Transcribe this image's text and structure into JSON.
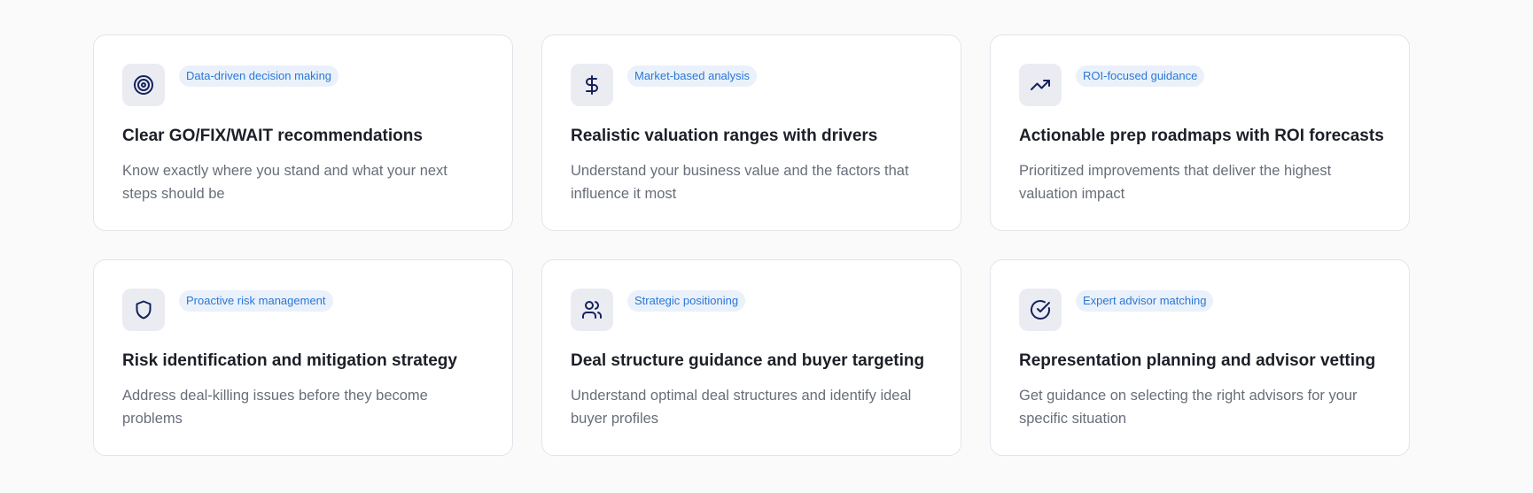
{
  "cards": [
    {
      "icon": "target-icon",
      "badge": "Data-driven decision making",
      "title": "Clear GO/FIX/WAIT recommendations",
      "description": "Know exactly where you stand and what your next steps should be"
    },
    {
      "icon": "dollar-icon",
      "badge": "Market-based analysis",
      "title": "Realistic valuation ranges with drivers",
      "description": "Understand your business value and the factors that influence it most"
    },
    {
      "icon": "trending-up-icon",
      "badge": "ROI-focused guidance",
      "title": "Actionable prep roadmaps with ROI forecasts",
      "description": "Prioritized improvements that deliver the highest valuation impact"
    },
    {
      "icon": "shield-icon",
      "badge": "Proactive risk management",
      "title": "Risk identification and mitigation strategy",
      "description": "Address deal-killing issues before they become problems"
    },
    {
      "icon": "users-icon",
      "badge": "Strategic positioning",
      "title": "Deal structure guidance and buyer targeting",
      "description": "Understand optimal deal structures and identify ideal buyer profiles"
    },
    {
      "icon": "check-circle-icon",
      "badge": "Expert advisor matching",
      "title": "Representation planning and advisor vetting",
      "description": "Get guidance on selecting the right advisors for your specific situation"
    }
  ],
  "colors": {
    "page_background": "#fafafa",
    "card_background": "#ffffff",
    "icon_background": "#eaecf2",
    "icon_stroke": "#14215c",
    "badge_background": "#eaf1fb",
    "badge_text": "#2a78d6",
    "title_text": "#1c1f26",
    "description_text": "#686e79"
  }
}
